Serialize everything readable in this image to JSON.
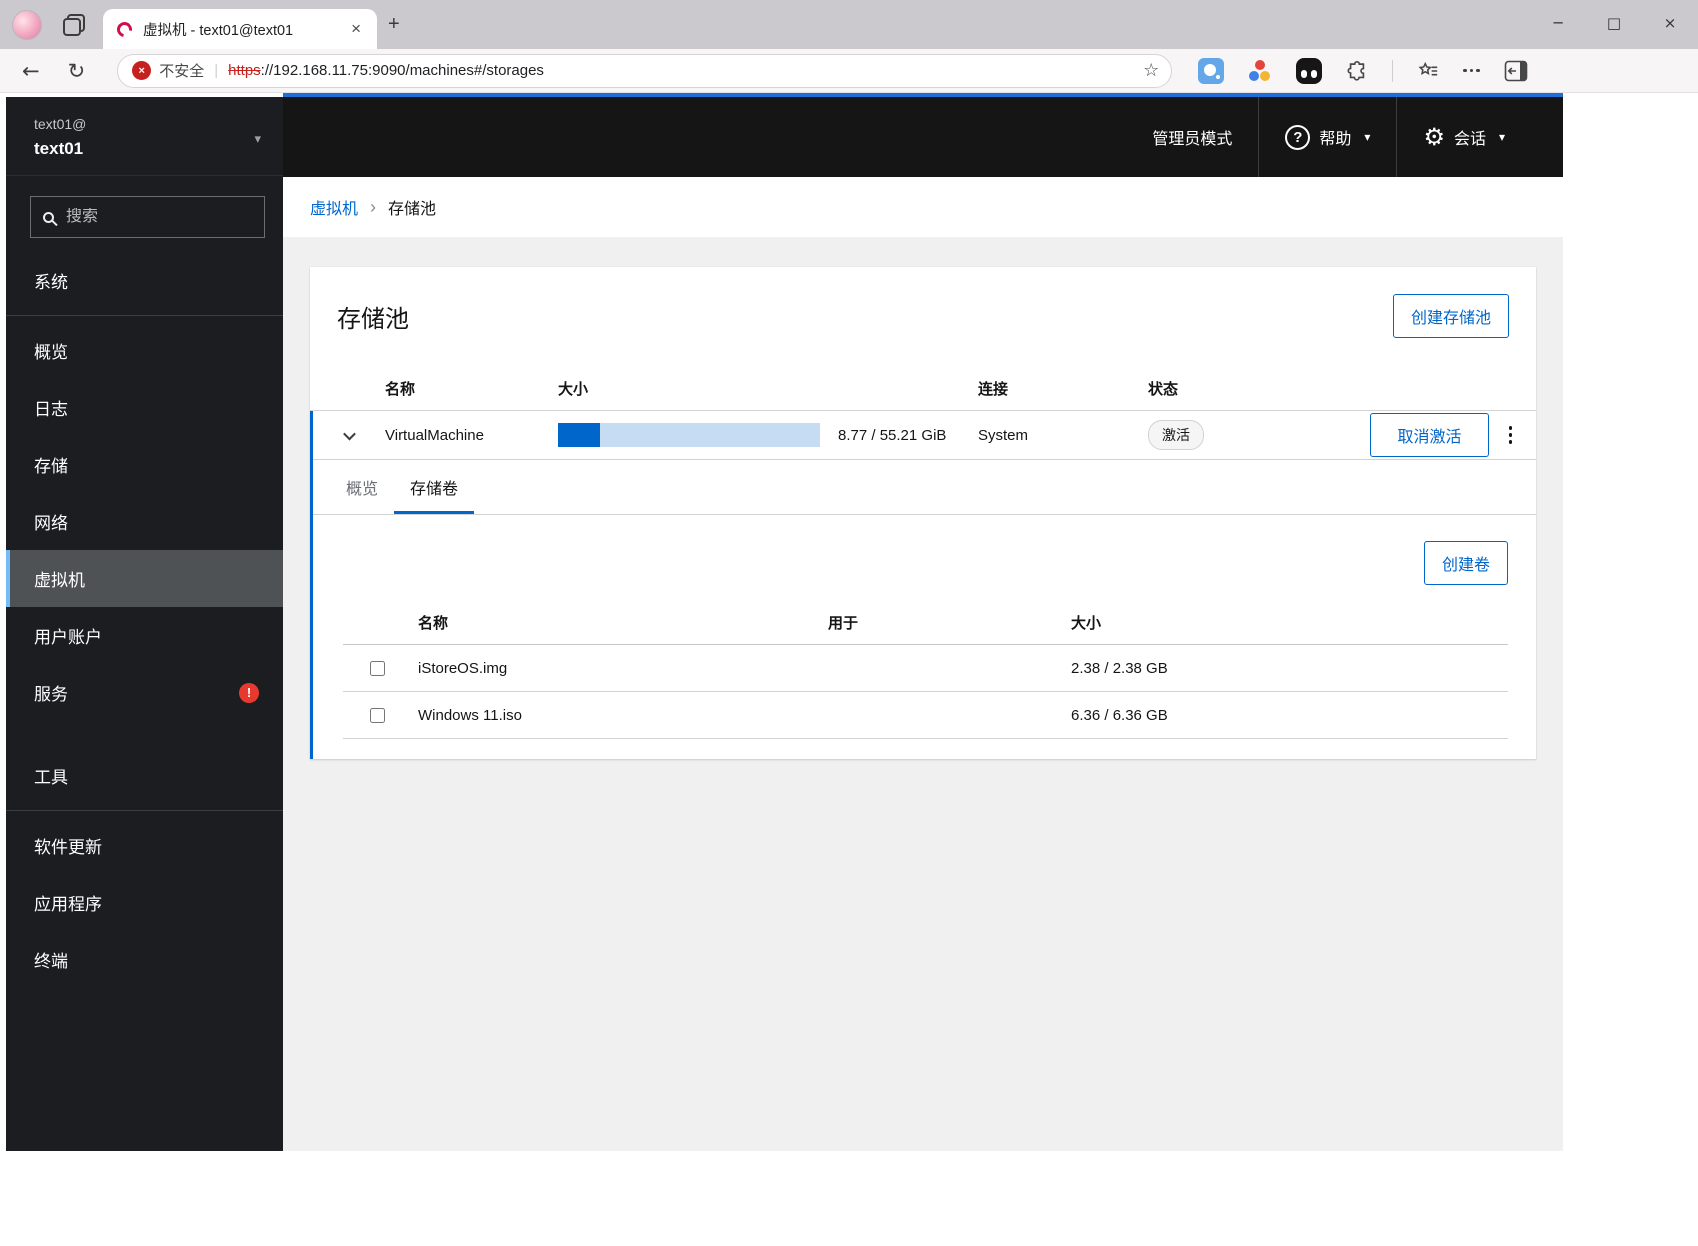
{
  "browser": {
    "tab_title": "虚拟机 - text01@text01",
    "address": {
      "security_label": "不安全",
      "protocol": "https",
      "url_rest": "://192.168.11.75:9090/machines#/storages"
    }
  },
  "icons": {
    "back": "←",
    "refresh": "↻",
    "bookmark_star": "☆",
    "new_tab": "+",
    "tab_close": "×",
    "window_minimize": "─",
    "window_maximize": "□",
    "window_close": "×",
    "insecure_x": "×",
    "help_question": "?",
    "gear": "⚙",
    "caret_down": "▾",
    "breadcrumb_separator": "›",
    "url_divider": "|"
  },
  "masthead": {
    "admin_mode_label": "管理员模式",
    "help_label": "帮助",
    "session_label": "会话"
  },
  "sidebar": {
    "host_user": "text01@",
    "host_name": "text01",
    "search_placeholder": "搜索",
    "items": [
      {
        "label": "系统"
      },
      {
        "label": "概览"
      },
      {
        "label": "日志"
      },
      {
        "label": "存储"
      },
      {
        "label": "网络"
      },
      {
        "label": "虚拟机"
      },
      {
        "label": "用户账户"
      },
      {
        "label": "服务",
        "badge": "!"
      },
      {
        "label": "工具"
      },
      {
        "label": "软件更新"
      },
      {
        "label": "应用程序"
      },
      {
        "label": "终端"
      }
    ]
  },
  "breadcrumb": {
    "parent": "虚拟机",
    "current": "存储池"
  },
  "pools": {
    "title": "存储池",
    "create_label": "创建存储池",
    "columns": {
      "name": "名称",
      "size": "大小",
      "connection": "连接",
      "state": "状态"
    },
    "row": {
      "name": "VirtualMachine",
      "usage_text": "8.77 / 55.21 GiB",
      "usage_percent": 15.9,
      "connection": "System",
      "state_badge": "激活",
      "deactivate_label": "取消激活"
    }
  },
  "volumes": {
    "tab_overview": "概览",
    "tab_volumes": "存储卷",
    "create_label": "创建卷",
    "columns": {
      "name": "名称",
      "used_by": "用于",
      "size": "大小"
    },
    "rows": [
      {
        "name": "iStoreOS.img",
        "used_by": "",
        "size": "2.38 / 2.38 GB"
      },
      {
        "name": "Windows 11.iso",
        "used_by": "",
        "size": "6.36 / 6.36 GB"
      }
    ]
  },
  "colors": {
    "accent_blue": "#0066cc",
    "masthead_bg": "#151515",
    "sidebar_bg": "#1b1d21",
    "nav_active_indicator": "#73bcf7",
    "danger_badge": "#e8392f",
    "progress_fill": "#0066cc",
    "progress_track": "#c6dcf2",
    "insecure_red": "#c5221f"
  }
}
